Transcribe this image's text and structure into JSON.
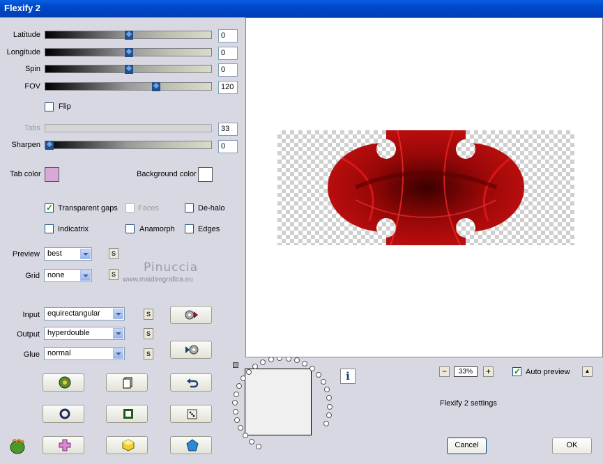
{
  "window": {
    "title": "Flexify 2"
  },
  "params": {
    "latitude": {
      "label": "Latitude",
      "value": "0",
      "level": 0.5
    },
    "longitude": {
      "label": "Longitude",
      "value": "0",
      "level": 0.5
    },
    "spin": {
      "label": "Spin",
      "value": "0",
      "level": 0.5
    },
    "fov": {
      "label": "FOV",
      "value": "120",
      "level": 0.667
    },
    "tabs": {
      "label": "Tabs",
      "value": "33"
    },
    "sharpen": {
      "label": "Sharpen",
      "value": "0",
      "level": 0
    }
  },
  "flip": {
    "label": "Flip",
    "checked": false
  },
  "colors": {
    "tab_color_label": "Tab color",
    "tab_color": "#d8a8d8",
    "bg_color_label": "Background color",
    "bg_color": "#ffffff"
  },
  "options": {
    "transparent_gaps": {
      "label": "Transparent gaps",
      "checked": true
    },
    "faces": {
      "label": "Faces",
      "checked": false
    },
    "dehalo": {
      "label": "De-halo",
      "checked": false
    },
    "indicatrix": {
      "label": "Indicatrix",
      "checked": false
    },
    "anamorph": {
      "label": "Anamorph",
      "checked": false
    },
    "edges": {
      "label": "Edges",
      "checked": false
    }
  },
  "selects": {
    "preview": {
      "label": "Preview",
      "value": "best"
    },
    "grid": {
      "label": "Grid",
      "value": "none"
    },
    "input": {
      "label": "Input",
      "value": "equirectangular"
    },
    "output": {
      "label": "Output",
      "value": "hyperdouble"
    },
    "glue": {
      "label": "Glue",
      "value": "normal"
    }
  },
  "s_label": "S",
  "watermark": {
    "name": "Pinuccia",
    "url": "www.maidiregrafica.eu"
  },
  "zoom": {
    "value": "33%",
    "minus": "−",
    "plus": "+"
  },
  "auto_preview": {
    "label": "Auto preview",
    "checked": true,
    "up": "▲"
  },
  "settings_text": "Flexify 2 settings",
  "info_label": "i",
  "buttons": {
    "cancel": "Cancel",
    "ok": "OK"
  }
}
